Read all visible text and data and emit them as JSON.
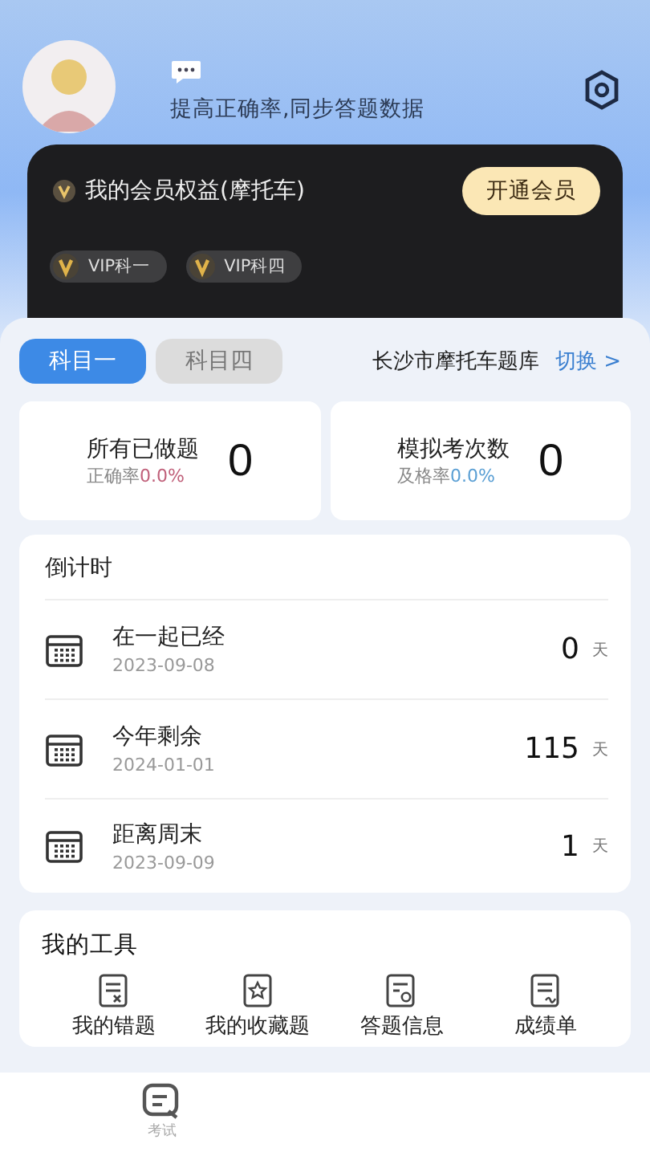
{
  "profile": {
    "subtitle": "提高正确率,同步答题数据"
  },
  "membership": {
    "title": "我的会员权益(摩托车)",
    "button": "开通会员",
    "badges": [
      "VIP科一",
      "VIP科四"
    ]
  },
  "tabs": [
    {
      "label": "科目一",
      "selected": true
    },
    {
      "label": "科目四",
      "selected": false
    }
  ],
  "bank": {
    "name": "长沙市摩托车题库",
    "switch": "切换 >"
  },
  "stats": [
    {
      "title": "所有已做题",
      "rate_label": "正确率",
      "rate": "0.0%",
      "value": "0",
      "color": "#c0607a"
    },
    {
      "title": "模拟考次数",
      "rate_label": "及格率",
      "rate": "0.0%",
      "value": "0",
      "color": "#5a9fd4"
    }
  ],
  "countdown": {
    "title": "倒计时",
    "rows": [
      {
        "label": "在一起已经",
        "date": "2023-09-08",
        "value": "0",
        "unit": "天"
      },
      {
        "label": "今年剩余",
        "date": "2024-01-01",
        "value": "115",
        "unit": "天"
      },
      {
        "label": "距离周末",
        "date": "2023-09-09",
        "value": "1",
        "unit": "天"
      }
    ]
  },
  "tools": {
    "title": "我的工具",
    "items": [
      {
        "label": "我的错题",
        "kind": "wrong"
      },
      {
        "label": "我的收藏题",
        "kind": "star"
      },
      {
        "label": "答题信息",
        "kind": "search"
      },
      {
        "label": "成绩单",
        "kind": "report"
      }
    ]
  },
  "bottom_nav": [
    {
      "label": "考试"
    }
  ]
}
